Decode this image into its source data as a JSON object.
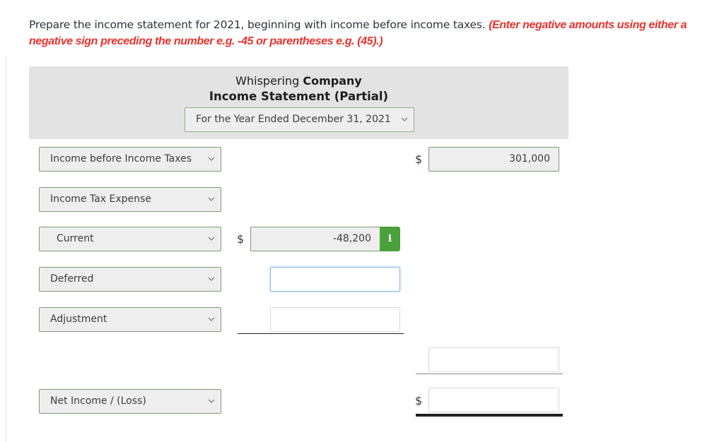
{
  "instructions": {
    "text": "Prepare the income statement for 2021, beginning with income before income taxes.",
    "note": "(Enter negative amounts using either a negative sign preceding the number e.g. -45 or parentheses e.g. (45).)"
  },
  "header": {
    "company_name_plain": "Whispering",
    "company_name_bold": "Company",
    "statement_title": "Income Statement (Partial)",
    "period_select": "For the Year Ended December 31, 2021"
  },
  "rows": [
    {
      "label": "Income before Income Taxes",
      "col1_value": "",
      "col2_value": "301,000"
    },
    {
      "label": "Income Tax Expense"
    },
    {
      "label": "Current",
      "col1_value": "-48,200"
    },
    {
      "label": "Deferred",
      "col1_value": ""
    },
    {
      "label": "Adjustment",
      "col1_value": ""
    },
    {
      "subtotal_value": ""
    },
    {
      "label": "Net Income / (Loss)",
      "col2_value": ""
    }
  ],
  "symbols": {
    "dollar": "$",
    "info": "i"
  },
  "colors": {
    "instruction_red": "#e8332d",
    "select_border": "#7d9b72",
    "info_green": "#4aa13b",
    "header_bg": "#e3e3e3"
  }
}
